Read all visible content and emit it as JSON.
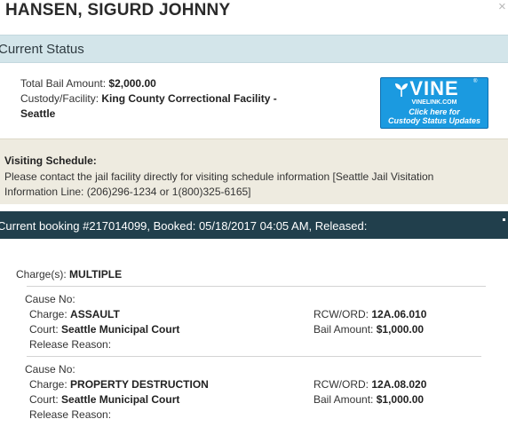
{
  "inmate": {
    "name": "HANSEN, SIGURD JOHNNY"
  },
  "dialog": {
    "close_glyph": "×"
  },
  "current_status": {
    "heading": "Current Status",
    "bail_label": "Total Bail Amount:",
    "bail_value": "$2,000.00",
    "custody_label": "Custody/Facility:",
    "custody_value_line1": "King County Correctional Facility -",
    "custody_value_line2": "Seattle"
  },
  "vine": {
    "logo": "VINE",
    "registered": "®",
    "site": "VINELINK.COM",
    "cta_line1": "Click here for",
    "cta_line2": "Custody Status Updates",
    "bg_color": "#1b9ae0"
  },
  "visiting": {
    "heading": "Visiting Schedule:",
    "body": "Please contact the jail facility directly for visiting schedule information [Seattle Jail Visitation Information Line: (206)296-1234 or 1(800)325-6165]"
  },
  "booking": {
    "header": "Current booking #217014099, Booked: 05/18/2017 04:05 AM, Released:",
    "header_bg": "#213f4c"
  },
  "charges": {
    "label": "Charge(s):",
    "value": "MULTIPLE",
    "items": [
      {
        "cause_label": "Cause No:",
        "charge_label": "Charge:",
        "charge": "ASSAULT",
        "court_label": "Court:",
        "court": "Seattle Municipal Court",
        "release_label": "Release Reason:",
        "rcw_label": "RCW/ORD:",
        "rcw": "12A.06.010",
        "bail_label": "Bail Amount:",
        "bail": "$1,000.00"
      },
      {
        "cause_label": "Cause No:",
        "charge_label": "Charge:",
        "charge": "PROPERTY DESTRUCTION",
        "court_label": "Court:",
        "court": "Seattle Municipal Court",
        "release_label": "Release Reason:",
        "rcw_label": "RCW/ORD:",
        "rcw": "12A.08.020",
        "bail_label": "Bail Amount:",
        "bail": "$1,000.00"
      }
    ]
  }
}
